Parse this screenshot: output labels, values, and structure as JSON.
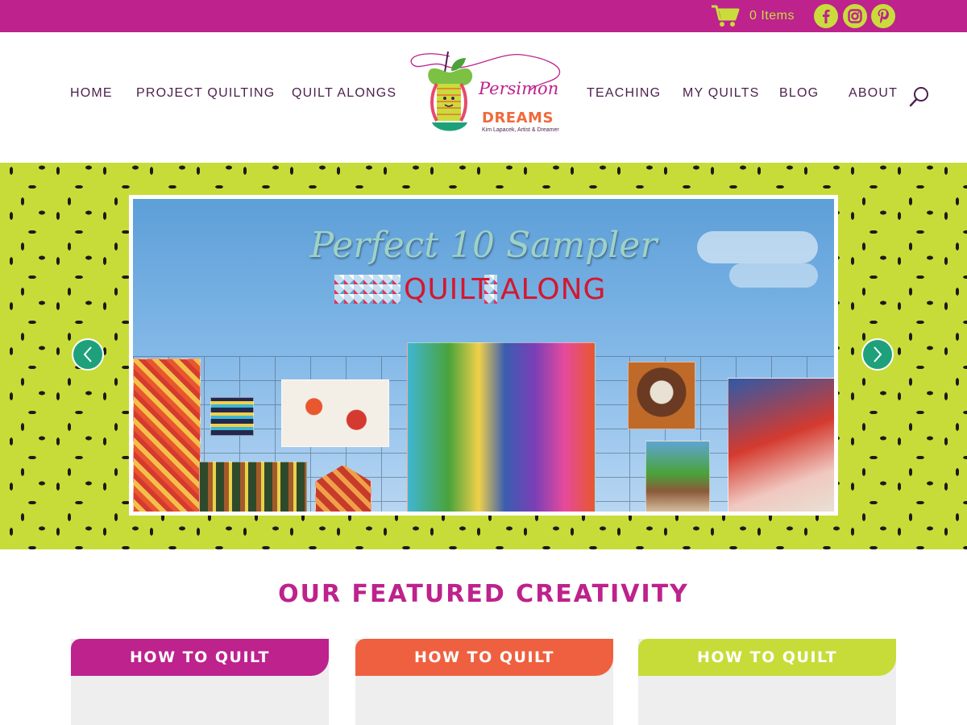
{
  "topbar": {
    "cart_text": "0 Items",
    "social": [
      {
        "name": "facebook",
        "icon": "facebook-icon"
      },
      {
        "name": "instagram",
        "icon": "instagram-icon"
      },
      {
        "name": "pinterest",
        "icon": "pinterest-icon"
      }
    ],
    "bg_color": "#bd228d",
    "accent_color": "#c9dc3c"
  },
  "logo": {
    "script": "Persimon",
    "word": "DREAMS",
    "tagline": "Kim Lapacek, Artist & Dreamer"
  },
  "nav": {
    "left": [
      "HOME",
      "PROJECT QUILTING",
      "QUILT ALONGS"
    ],
    "right": [
      "TEACHING",
      "MY QUILTS",
      "BLOG",
      "ABOUT"
    ]
  },
  "hero": {
    "title_script": "Perfect 10 Sampler",
    "title_block": "QUILT ALONG",
    "bg_color": "#c7dc38",
    "arrow_color": "#1ea17a"
  },
  "featured": {
    "title": "OUR FEATURED CREATIVITY",
    "cards": [
      {
        "label": "HOW TO QUILT",
        "color": "#bd228d"
      },
      {
        "label": "HOW TO QUILT",
        "color": "#ef6040"
      },
      {
        "label": "HOW TO QUILT",
        "color": "#c7dc38"
      }
    ]
  }
}
